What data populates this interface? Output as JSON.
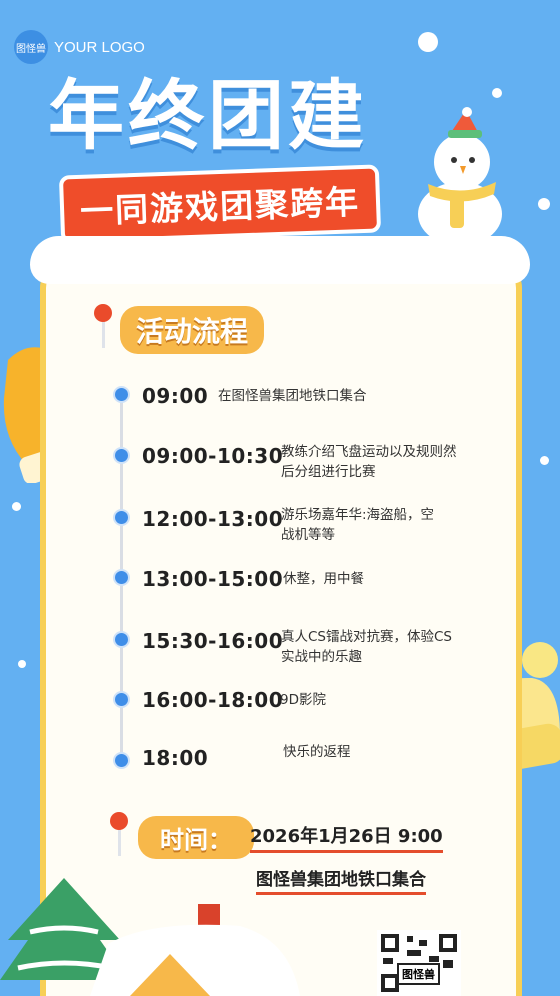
{
  "brand": {
    "badge": "图怪兽",
    "logo_text": "YOUR LOGO"
  },
  "header": {
    "title": "年终团建",
    "subtitle": "一同游戏团聚跨年"
  },
  "schedule": {
    "section_label": "活动流程",
    "items": [
      {
        "time": "09:00",
        "desc": "在图怪兽集团地铁口集合"
      },
      {
        "time": "09:00-10:30",
        "desc": "教练介绍飞盘运动以及规则然后分组进行比赛"
      },
      {
        "time": "12:00-13:00",
        "desc": "游乐场嘉年华:海盗船，空战机等等"
      },
      {
        "time": "13:00-15:00",
        "desc": "休整，用中餐"
      },
      {
        "time": "15:30-16:00",
        "desc": "真人CS镭战对抗赛，体验CS实战中的乐趣"
      },
      {
        "time": "16:00-18:00",
        "desc": "9D影院"
      },
      {
        "time": "18:00",
        "desc": "快乐的返程"
      }
    ]
  },
  "time_section": {
    "label": "时间：",
    "date": "2026年1月26日  9:00",
    "place": "图怪兽集团地铁口集合"
  },
  "qr": {
    "label": "图怪兽"
  },
  "colors": {
    "sky": "#63b0f2",
    "card_border": "#f7cf56",
    "accent_red": "#ea4b2b",
    "tag_orange": "#f7b84a",
    "timeline_blue": "#3f8ee8"
  }
}
